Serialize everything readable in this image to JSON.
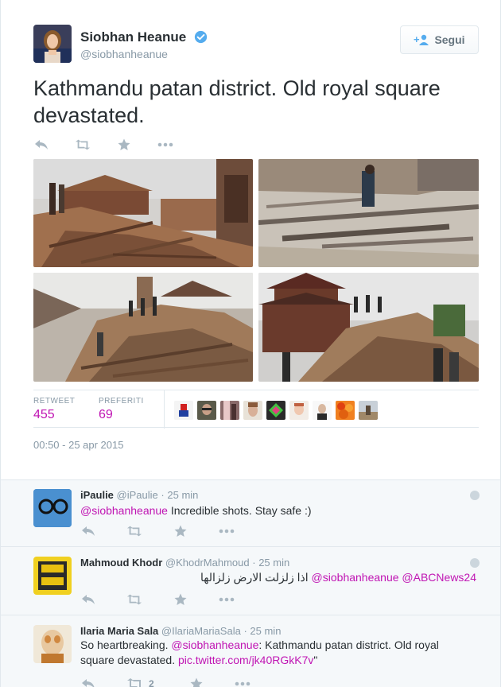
{
  "author": {
    "name": "Siobhan Heanue",
    "handle": "@siobhanheanue"
  },
  "follow_button": {
    "label": "Segui"
  },
  "tweet": {
    "text": "Kathmandu patan district. Old royal square devastated.",
    "retweet_label": "RETWEET",
    "retweet_count": "455",
    "favorites_label": "PREFERITI",
    "favorites_count": "69",
    "timestamp": "00:50 - 25 apr 2015"
  },
  "replies": [
    {
      "name": "iPaulie",
      "handle": "@iPaulie",
      "sep": "·",
      "time": "25 min",
      "mention": "@siobhanheanue",
      "text": " Incredible shots. Stay safe :)"
    },
    {
      "name": "Mahmoud Khodr",
      "handle": "@KhodrMahmoud",
      "sep": "·",
      "time": "25 min",
      "mention1": "@siobhanheanue",
      "mention2": "@ABCNews24",
      "arabic": "اذا زلزلت الارض زلزالها"
    },
    {
      "name": "Ilaria Maria Sala",
      "handle": "@IlariaMariaSala",
      "sep": "·",
      "time": "25 min",
      "prefix": "So heartbreaking. ",
      "mention": "@siobhanheanue",
      "middle": ": Kathmandu patan district. Old royal square devastated. ",
      "link": "pic.twitter.com/jk40RGkK7v",
      "suffix": "\"",
      "retweet_count": "2"
    }
  ],
  "colors": {
    "accent": "#c015b3",
    "muted": "#8899a6",
    "verified": "#55acee"
  }
}
